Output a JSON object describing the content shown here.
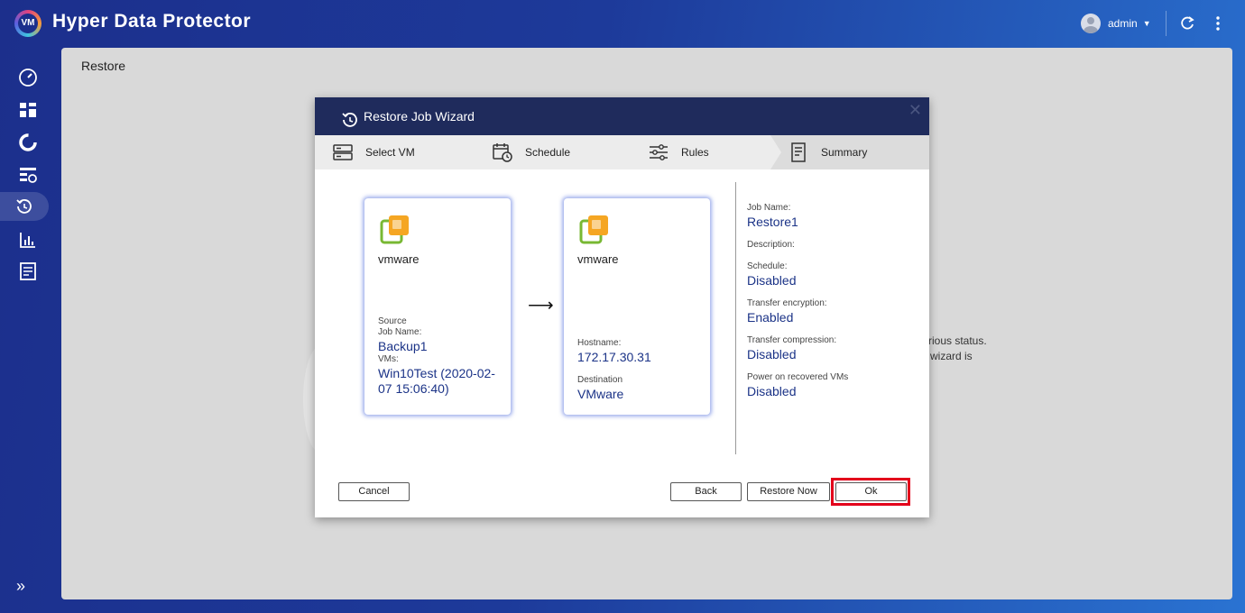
{
  "app": {
    "title": "Hyper Data Protector",
    "logo_text": "VM"
  },
  "header": {
    "user": "admin"
  },
  "page": {
    "title": "Restore",
    "bg_text_1": "rious status.",
    "bg_text_2": "wizard is"
  },
  "dialog": {
    "title": "Restore Job Wizard",
    "steps": [
      "Select VM",
      "Schedule",
      "Rules",
      "Summary"
    ],
    "source": {
      "vendor": "vmware",
      "caption": "Source",
      "job_name_label": "Job Name:",
      "job_name": "Backup1",
      "vms_label": "VMs:",
      "vms": "Win10Test (2020-02-07 15:06:40)"
    },
    "destination": {
      "vendor": "vmware",
      "hostname_label": "Hostname:",
      "hostname": "172.17.30.31",
      "destination_label": "Destination",
      "destination": "VMware"
    },
    "summary": [
      {
        "label": "Job Name:",
        "value": "Restore1"
      },
      {
        "label": "Description:",
        "value": ""
      },
      {
        "label": "Schedule:",
        "value": "Disabled"
      },
      {
        "label": "Transfer encryption:",
        "value": "Enabled"
      },
      {
        "label": "Transfer compression:",
        "value": "Disabled"
      },
      {
        "label": "Power on recovered VMs",
        "value": "Disabled"
      }
    ],
    "buttons": {
      "cancel": "Cancel",
      "back": "Back",
      "restore_now": "Restore Now",
      "ok": "Ok"
    }
  },
  "icons": {
    "sidebar": [
      "dashboard-gauge-icon",
      "overview-grid-icon",
      "backup-icon",
      "replication-icon",
      "restore-icon",
      "report-icon",
      "log-icon"
    ],
    "header": [
      "refresh-icon",
      "more-options-icon"
    ]
  },
  "colors": {
    "header_bar": "#1f2b5c",
    "value_text": "#1b3387",
    "highlight": "#e3001b",
    "vmware_orange": "#f5a623",
    "vmware_green": "#78b833"
  }
}
